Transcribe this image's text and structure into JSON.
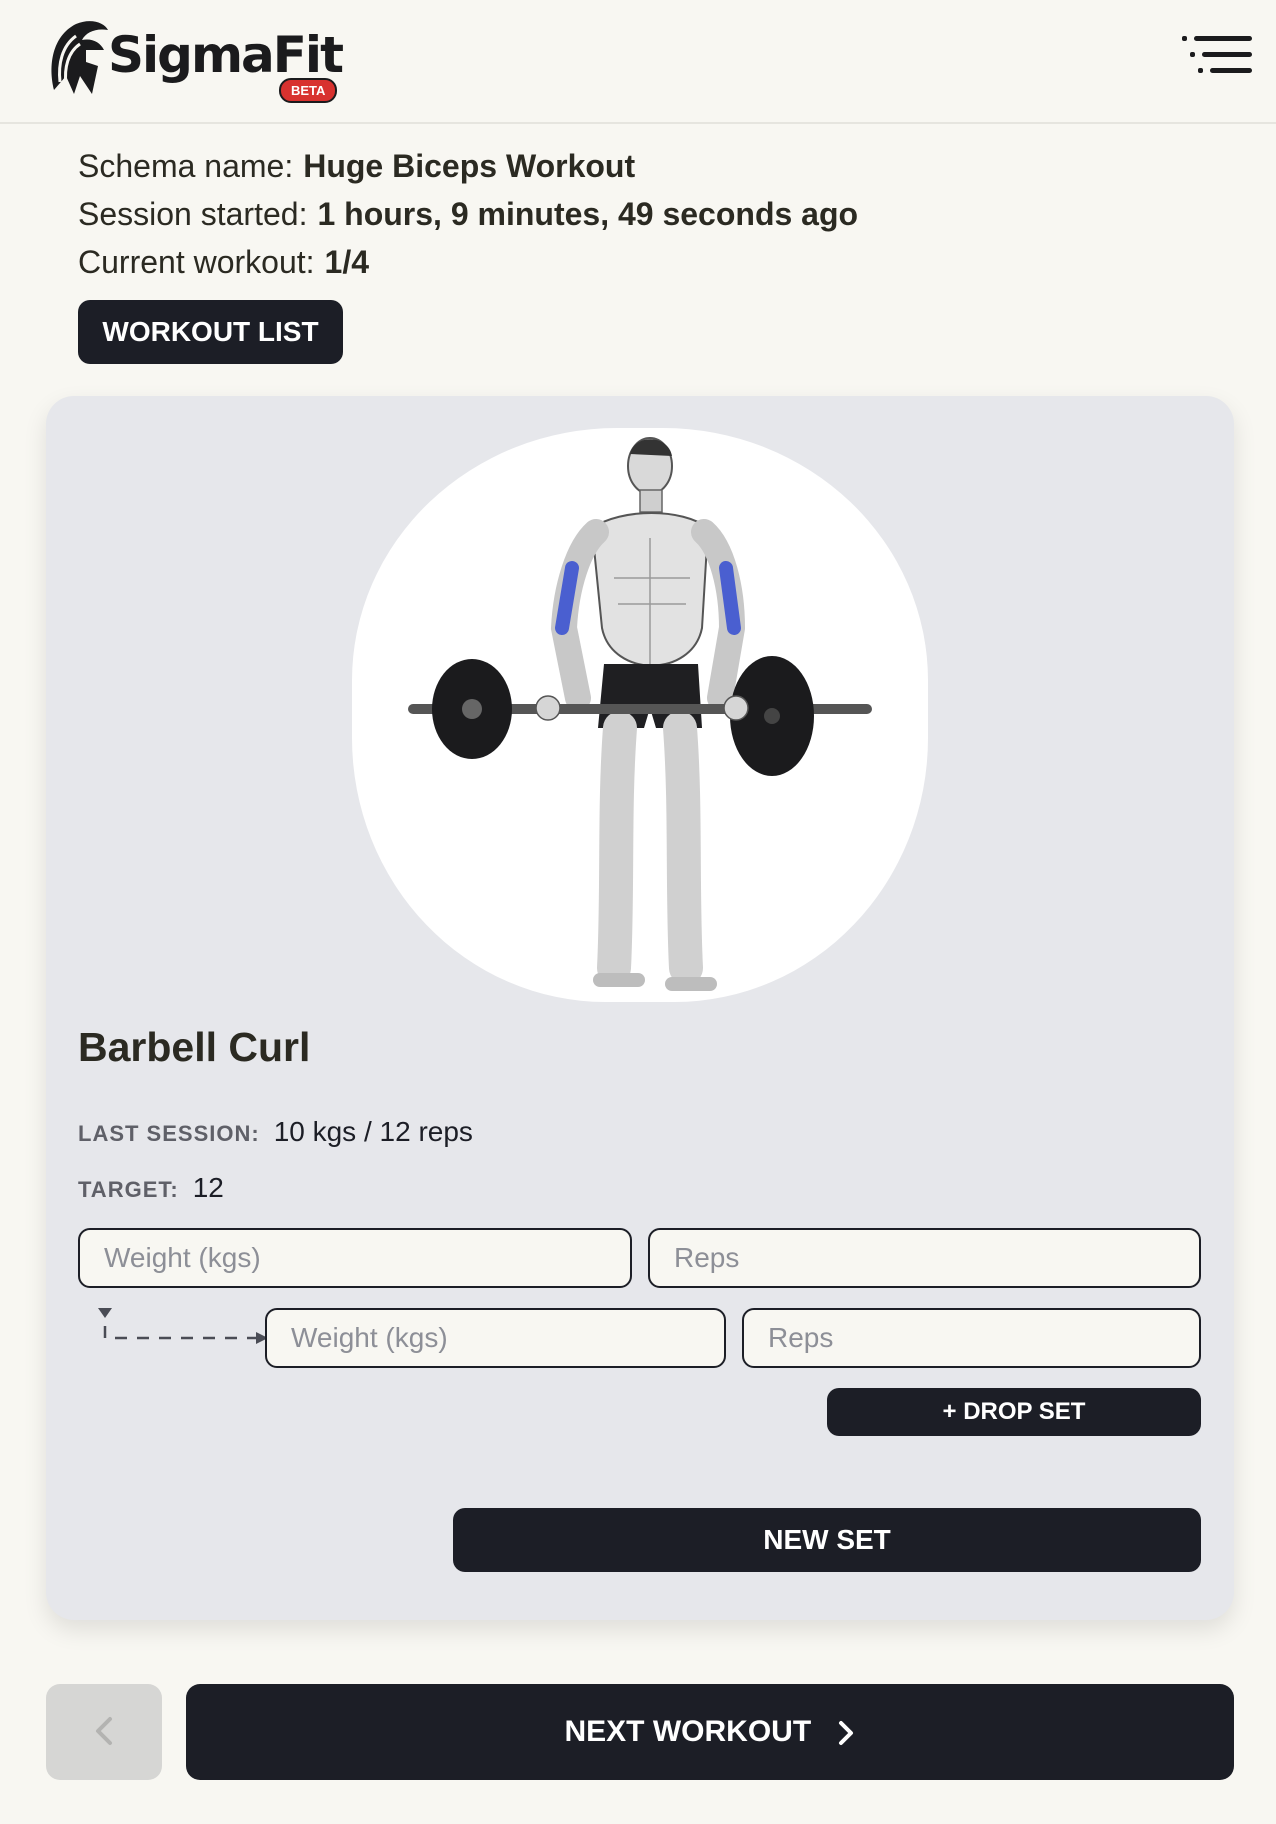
{
  "header": {
    "logo_text": "SigmaFit",
    "beta_badge": "BETA",
    "menu_icon": "menu-lines-icon"
  },
  "session": {
    "schema_label": "Schema name:",
    "schema_value": "Huge Biceps Workout",
    "started_label": "Session started:",
    "started_value": "1 hours, 9 minutes, 49 seconds ago",
    "current_label": "Current workout:",
    "current_value": "1/4",
    "workout_list_button": "WORKOUT LIST"
  },
  "exercise": {
    "illustration_icon": "barbell-curl-figure-icon",
    "name": "Barbell Curl",
    "last_session_label": "LAST SESSION:",
    "last_session_value": "10 kgs / 12 reps",
    "target_label": "TARGET:",
    "target_value": "12"
  },
  "sets": {
    "weight_placeholder": "Weight (kgs)",
    "reps_placeholder": "Reps",
    "drop_weight_placeholder": "Weight (kgs)",
    "drop_reps_placeholder": "Reps",
    "drop_set_button": "+ DROP SET",
    "new_set_button": "NEW SET"
  },
  "nav": {
    "prev_icon": "chevron-left-icon",
    "next_label": "NEXT WORKOUT",
    "next_icon": "chevron-right-icon"
  },
  "colors": {
    "background": "#f8f7f2",
    "card": "#e6e7eb",
    "dark_button": "#1c1e26",
    "beta_badge": "#d8322f",
    "muscle_highlight": "#4a5fd0"
  }
}
